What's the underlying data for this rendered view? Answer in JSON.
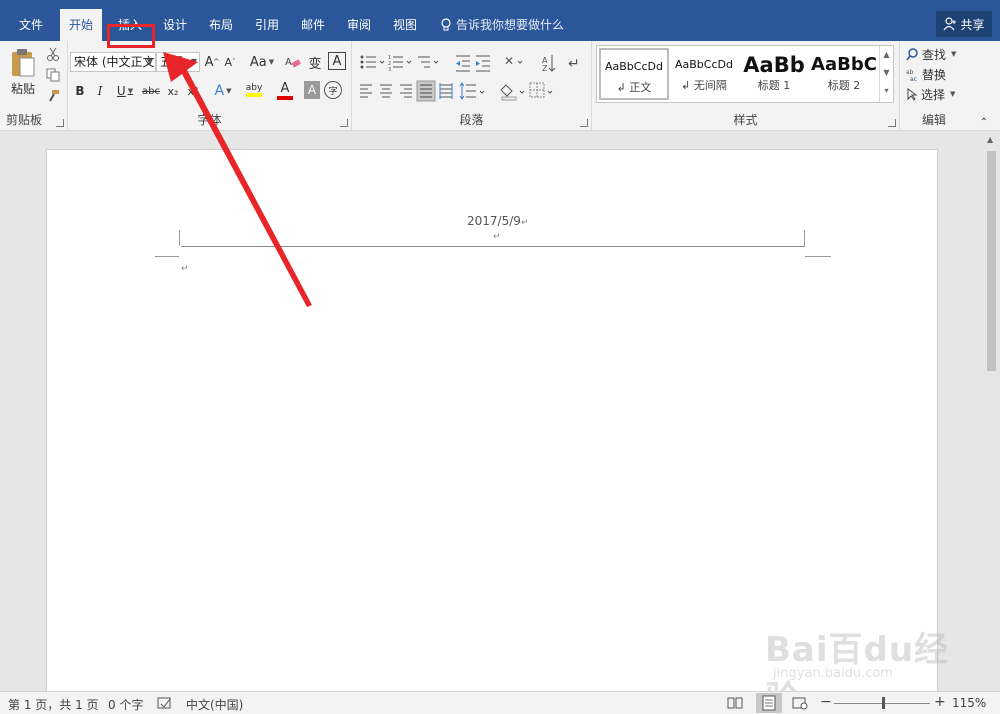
{
  "tabs": [
    {
      "label": "文件"
    },
    {
      "label": "开始"
    },
    {
      "label": "插入"
    },
    {
      "label": "设计"
    },
    {
      "label": "布局"
    },
    {
      "label": "引用"
    },
    {
      "label": "邮件"
    },
    {
      "label": "审阅"
    },
    {
      "label": "视图"
    }
  ],
  "tellme": "告诉我你想要做什么",
  "share": "共享",
  "clipboard": {
    "paste": "粘贴",
    "label": "剪贴板"
  },
  "font": {
    "name": "宋体 (中文正文",
    "size": "五号",
    "label": "字体",
    "aa_label": "Aa",
    "wen": "变",
    "bold": "B",
    "italic": "I",
    "underline": "U",
    "strike": "abc",
    "sub": "x₂",
    "sup": "x²",
    "grow": "A",
    "shrink": "A",
    "effects": "A",
    "highlight": "aby",
    "color": "A",
    "shade": "A",
    "circle": "字",
    "boxed": "A"
  },
  "paragraph": {
    "label": "段落"
  },
  "styles": {
    "label": "样式",
    "items": [
      {
        "sample": "AaBbCcDd",
        "name": "↲ 正文"
      },
      {
        "sample": "AaBbCcDd",
        "name": "↲ 无间隔"
      },
      {
        "sample": "AaBb",
        "name": "标题 1"
      },
      {
        "sample": "AaBbC",
        "name": "标题 2"
      }
    ]
  },
  "editing": {
    "find": "查找",
    "replace": "替换",
    "select": "选择",
    "label": "编辑"
  },
  "doc": {
    "header_date": "2017/5/9",
    "pilcrow": "↵"
  },
  "status": {
    "page": "第 1 页，共 1 页",
    "words": "0 个字",
    "lang": "中文(中国)",
    "zoom": "115%",
    "zoom_minus": "−",
    "zoom_plus": "+"
  },
  "watermark": {
    "main": "Bai百du经验",
    "sub": "jingyan.baidu.com"
  },
  "colors": {
    "tabbar": "#2b579a",
    "annotation": "#e8262a",
    "font_color_bar": "#e00000",
    "highlight_bar": "#ffff00"
  }
}
